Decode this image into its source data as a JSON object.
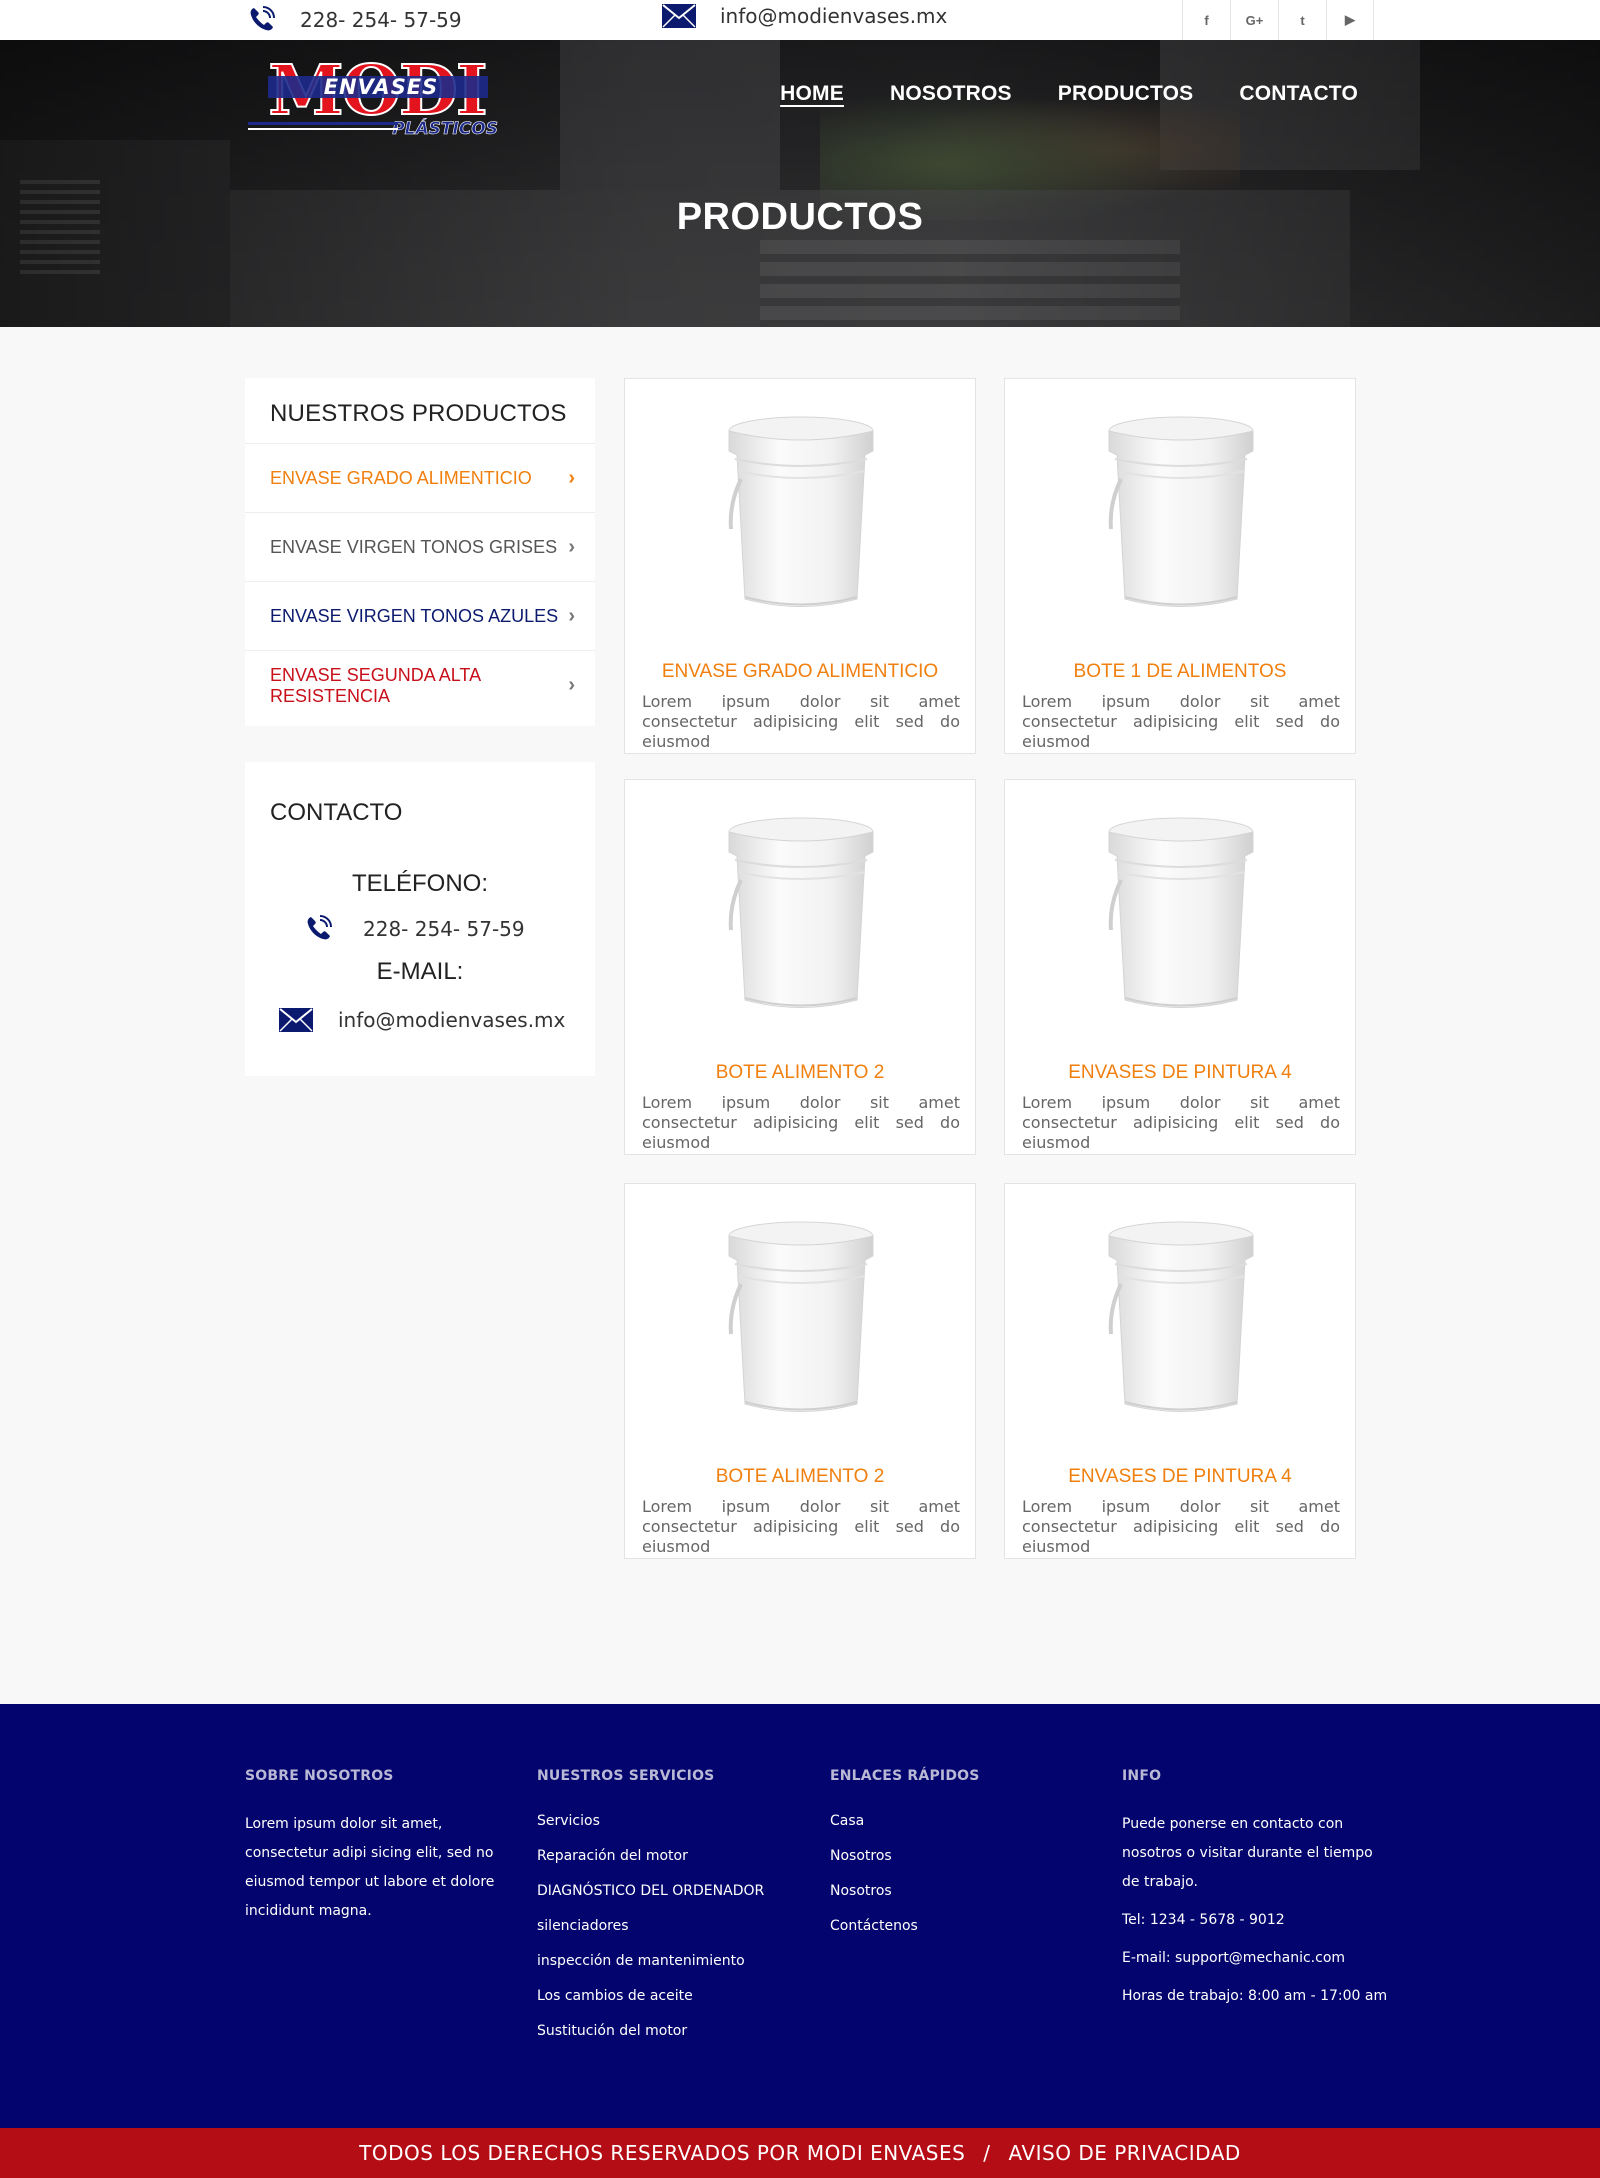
{
  "topbar": {
    "phone": "228- 254- 57-59",
    "email": "info@modienvases.mx",
    "socials": [
      {
        "icon": "facebook-icon",
        "glyph": "f"
      },
      {
        "icon": "google-plus-icon",
        "glyph": "G+"
      },
      {
        "icon": "twitter-icon",
        "glyph": "t"
      },
      {
        "icon": "youtube-icon",
        "glyph": "▶"
      }
    ]
  },
  "logo": {
    "main": "MODI",
    "sub1": "ENVASES",
    "sub2": "PLÁSTICOS"
  },
  "nav": {
    "home": "HOME",
    "nosotros": "NOSOTROS",
    "productos": "PRODUCTOS",
    "contacto": "CONTACTO"
  },
  "hero": {
    "title": "PRODUCTOS"
  },
  "sidebar": {
    "products_title": "NUESTROS PRODUCTOS",
    "items": [
      {
        "label": "ENVASE GRADO ALIMENTICIO",
        "color": "#f07f0e"
      },
      {
        "label": "ENVASE VIRGEN TONOS GRISES",
        "color": "#555555"
      },
      {
        "label": "ENVASE VIRGEN TONOS AZULES",
        "color": "#0b1a6e"
      },
      {
        "label": "ENVASE SEGUNDA ALTA RESISTENCIA",
        "color": "#c8101a"
      }
    ],
    "contact_title": "CONTACTO",
    "phone_label": "TELÉFONO:",
    "phone": "228- 254- 57-59",
    "email_label": "E-MAIL:",
    "email": "info@modienvases.mx"
  },
  "products": [
    {
      "title": "ENVASE GRADO ALIMENTICIO",
      "desc": "Lorem ipsum dolor sit amet consectetur adipisicing elit sed do eiusmod"
    },
    {
      "title": "BOTE 1 DE ALIMENTOS",
      "desc": "Lorem ipsum dolor sit amet consectetur adipisicing elit sed do eiusmod"
    },
    {
      "title": "BOTE ALIMENTO 2",
      "desc": "Lorem ipsum dolor sit amet consectetur adipisicing elit sed do eiusmod"
    },
    {
      "title": "ENVASES DE PINTURA 4",
      "desc": "Lorem ipsum dolor sit amet consectetur adipisicing elit sed do eiusmod"
    },
    {
      "title": "BOTE ALIMENTO 2",
      "desc": "Lorem ipsum dolor sit amet consectetur adipisicing elit sed do eiusmod"
    },
    {
      "title": "ENVASES DE PINTURA 4",
      "desc": "Lorem ipsum dolor sit amet consectetur adipisicing elit sed do eiusmod"
    }
  ],
  "footer": {
    "about_title": "SOBRE NOSOTROS",
    "about_text": "Lorem ipsum dolor sit amet, consectetur adipi sicing elit, sed no eiusmod tempor ut labore et dolore incididunt magna.",
    "services_title": "NUESTROS SERVICIOS",
    "services": [
      "Servicios",
      "Reparación del motor",
      "DIAGNÓSTICO DEL ORDENADOR",
      "silenciadores",
      "inspección de mantenimiento",
      "Los cambios de aceite",
      "Sustitución del motor"
    ],
    "links_title": "ENLACES RÁPIDOS",
    "links": [
      "Casa",
      "Nosotros",
      "Nosotros",
      "Contáctenos"
    ],
    "info_title": "INFO",
    "info_text": "Puede ponerse en contacto con nosotros o visitar durante el tiempo de trabajo.",
    "info_tel": "Tel: 1234 - 5678 - 9012",
    "info_email": "E-mail: support@mechanic.com",
    "info_hours": "Horas de trabajo: 8:00 am - 17:00 am"
  },
  "bottombar": {
    "rights": "TODOS LOS DERECHOS RESERVADOS POR MODI ENVASES",
    "separator": "/",
    "privacy": "AVISO DE PRIVACIDAD"
  },
  "colors": {
    "accent_orange": "#f07f0e",
    "footer_navy": "#04046e",
    "bottom_red": "#b50d16",
    "icon_navy": "#0b1a6e"
  }
}
